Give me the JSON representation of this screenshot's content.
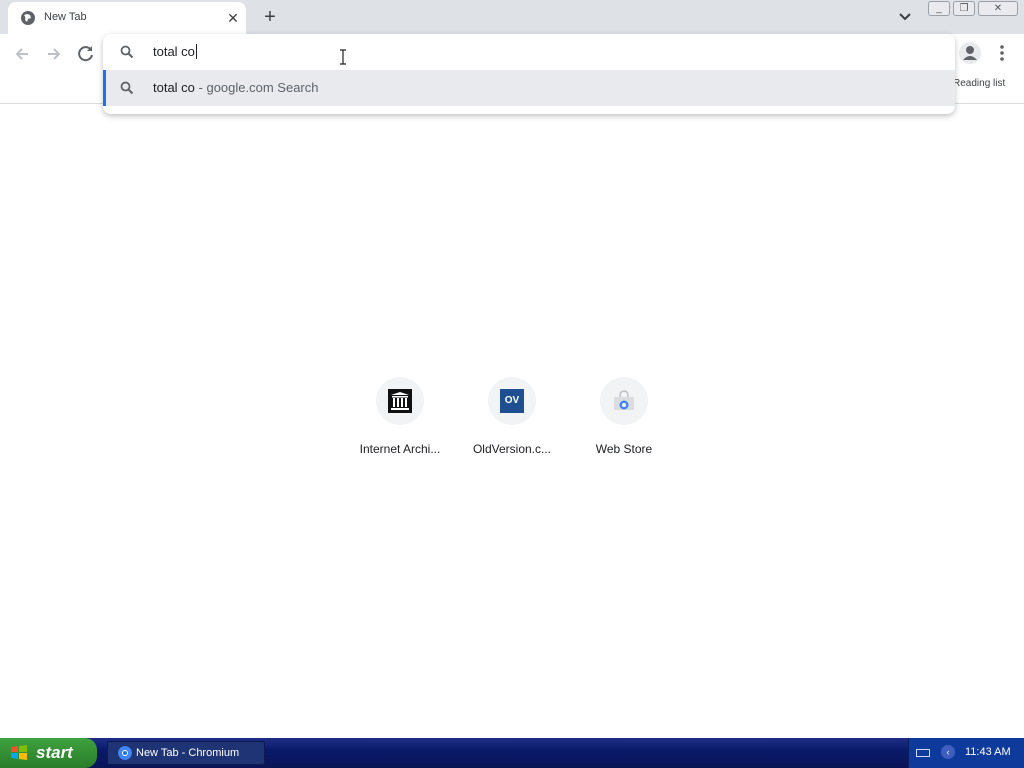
{
  "browser": {
    "tab": {
      "title": "New Tab"
    },
    "window_controls": {
      "minimize": "_",
      "restore": "❐",
      "close": "✕"
    }
  },
  "toolbar": {
    "reading_list_label": "Reading list"
  },
  "omnibox": {
    "input_value": "total co",
    "suggestion": {
      "main": "total co",
      "sub": " - google.com Search"
    }
  },
  "shortcuts": [
    {
      "label": "Internet Archi...",
      "icon": "internet-archive-icon"
    },
    {
      "label": "OldVersion.c...",
      "icon": "oldversion-icon",
      "icon_text": "OV"
    },
    {
      "label": "Web Store",
      "icon": "web-store-icon"
    }
  ],
  "taskbar": {
    "start_label": "start",
    "window_label": "New Tab - Chromium",
    "clock": "11:43 AM"
  },
  "colors": {
    "accent": "#1a73e8",
    "tabstrip": "#dee1e6",
    "taskbar": "#0a1a6a",
    "start_button": "#3ea13e"
  }
}
